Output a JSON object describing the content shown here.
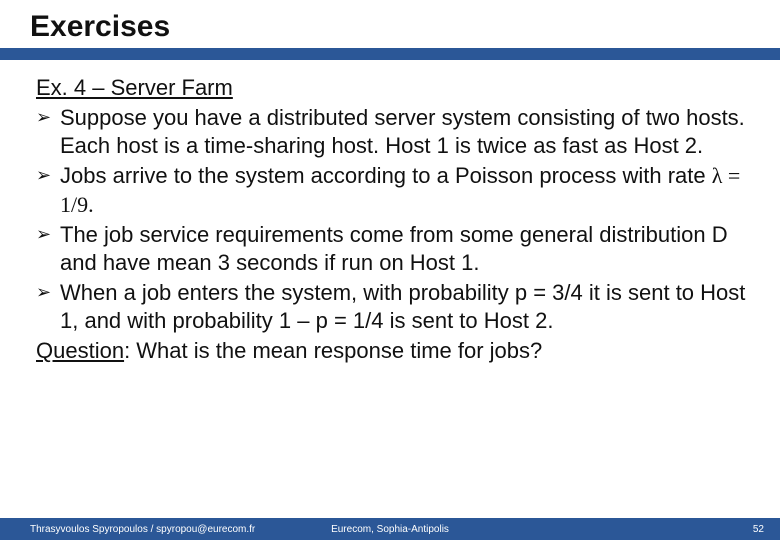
{
  "title": "Exercises",
  "exercise_heading": "Ex. 4 – Server Farm",
  "bullets": [
    "Suppose you have a distributed server system consisting of two hosts. Each host is a time-sharing host. Host 1 is twice as fast as Host 2.",
    "Jobs arrive to the system according to a Poisson process with rate ",
    "The job service requirements come from some general distribution D and have mean 3 seconds if run on Host 1.",
    "When a job enters the system, with probability p = 3/4 it is sent to Host 1, and with probability 1 – p = 1/4 is sent to Host 2."
  ],
  "rate_expr": "λ = 1/9.",
  "question_label": "Question",
  "question_text": ": What is the mean response time for jobs?",
  "footer": {
    "left": "Thrasyvoulos Spyropoulos / spyropou@eurecom.fr",
    "center": "Eurecom, Sophia-Antipolis",
    "right": "52"
  }
}
